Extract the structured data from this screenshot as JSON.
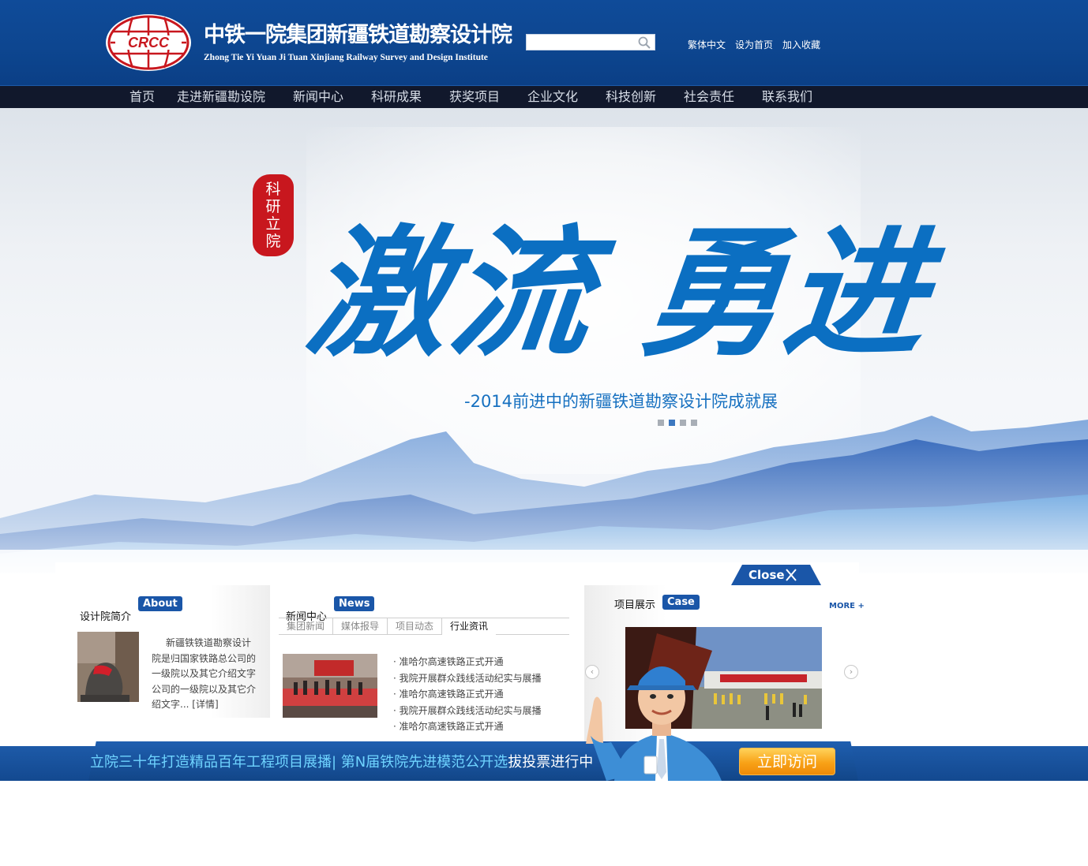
{
  "header": {
    "title": "中铁一院集团新疆铁道勘察设计院",
    "subtitle": "Zhong Tie Yi Yuan Ji Tuan Xinjiang Railway Survey and Design Institute",
    "logo_text": "CRCC",
    "search": {
      "placeholder": "",
      "icon": "search-icon"
    },
    "links": [
      "繁体中文",
      "设为首页",
      "加入收藏"
    ]
  },
  "nav": {
    "items": [
      "首页",
      "走进新疆勘设院",
      "新闻中心",
      "科研成果",
      "获奖项目",
      "企业文化",
      "科技创新",
      "社会责任",
      "联系我们"
    ]
  },
  "banner": {
    "seal_text": "科研立院",
    "slogan": "激流 勇进",
    "sub_slogan": "-2014前进中的新疆铁道勘察设计院成就展",
    "slides": 4,
    "active_slide": 2
  },
  "close": {
    "label": "Close"
  },
  "about": {
    "title": "设计院简介",
    "badge": "About",
    "text": "新疆铁铁道勘察设计院是归国家铁路总公司的一级院以及其它介绍文字公司的一级院以及其它介绍文字...",
    "more": "[详情]"
  },
  "news": {
    "title": "新闻中心",
    "badge": "News",
    "tabs": [
      "集团新闻",
      "媒体报导",
      "项目动态",
      "行业资讯"
    ],
    "active_tab": 3,
    "items": [
      "· 准哈尔高速铁路正式开通",
      "· 我院开展群众践线活动纪实与展播",
      "· 准哈尔高速铁路正式开通",
      "· 我院开展群众践线活动纪实与展播",
      "· 准哈尔高速铁路正式开通"
    ]
  },
  "cases": {
    "title": "项目展示",
    "badge": "Case",
    "more": "MORE +"
  },
  "bottom": {
    "text_main": "立院三十年打造精品百年工程项目展播| 第N届铁院先进模范公开选",
    "text_highlight": "拔投票进行中",
    "button": "立即访问"
  },
  "colors": {
    "header_blue": "#0d4690",
    "nav_dark": "#11182c",
    "slogan_blue": "#0b6fc2",
    "seal_red": "#c8171e",
    "badge_blue": "#1a56a8",
    "button_orange": "#f8a217"
  }
}
